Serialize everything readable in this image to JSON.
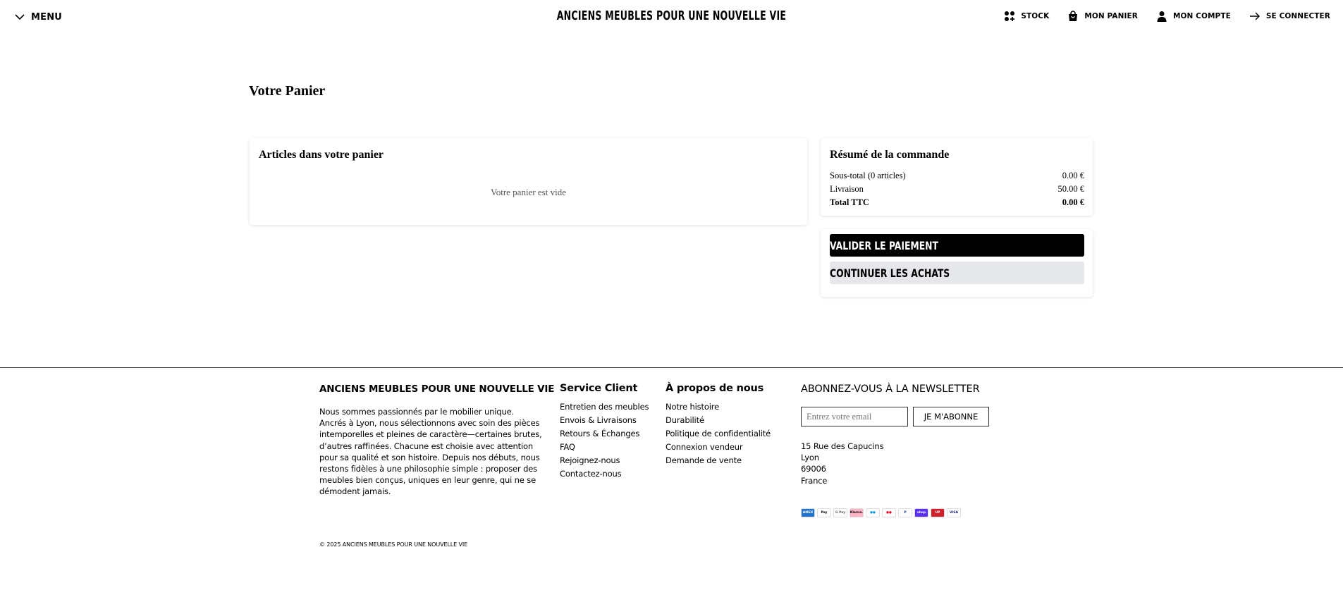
{
  "header": {
    "menu_label": "MENU",
    "logo": "ANCIENS MEUBLES POUR UNE NOUVELLE VIE",
    "nav": [
      {
        "label": "STOCK",
        "icon": "grid-plus-icon"
      },
      {
        "label": "MON PANIER",
        "icon": "shopping-bag-icon"
      },
      {
        "label": "MON COMPTE",
        "icon": "user-icon"
      },
      {
        "label": "SE CONNECTER",
        "icon": "arrow-right-icon"
      }
    ]
  },
  "main": {
    "page_title": "Votre Panier",
    "cart": {
      "title": "Articles dans votre panier",
      "empty_message": "Votre panier est vide"
    },
    "summary": {
      "title": "Résumé de la commande",
      "rows": [
        {
          "label": "Sous-total (0 articles)",
          "value": "0.00 €"
        },
        {
          "label": "Livraison",
          "value": "50.00 €"
        },
        {
          "label": "Total TTC",
          "value": "0.00 €"
        }
      ]
    },
    "actions": {
      "pay_label": "VALIDER LE PAIEMENT",
      "continue_label": "CONTINUER LES ACHATS"
    }
  },
  "footer": {
    "brand": "ANCIENS MEUBLES POUR UNE NOUVELLE VIE",
    "description": "Nous sommes passionnés par le mobilier unique. Ancrés à Lyon, nous sélectionnons avec soin des pièces intemporelles et pleines de caractère—certaines brutes, d’autres raffinées. Chacune est choisie avec attention pour sa qualité et son histoire. Depuis nos débuts, nous restons fidèles à une philosophie simple : proposer des meubles bien conçus, uniques en leur genre, qui ne se démodent jamais.",
    "service": {
      "title": "Service Client",
      "links": [
        "Entretien des meubles",
        "Envois & Livraisons",
        "Retours & Échanges",
        "FAQ",
        "Rejoignez-nous",
        "Contactez-nous"
      ]
    },
    "about": {
      "title": "À propos de nous",
      "links": [
        "Notre histoire",
        "Durabilité",
        "Politique de confidentialité",
        "Connexion vendeur",
        "Demande de vente"
      ]
    },
    "newsletter": {
      "title": "ABONNEZ-VOUS À LA NEWSLETTER",
      "placeholder": "Entrez votre email",
      "button": "JE M'ABONNE"
    },
    "address": [
      "15 Rue des Capucins",
      "Lyon",
      "69006",
      "France"
    ],
    "payments": [
      {
        "name": "AMEX",
        "bg": "#1f72cd",
        "fg": "#ffffff"
      },
      {
        "name": "Pay",
        "bg": "#ffffff",
        "fg": "#000000"
      },
      {
        "name": "G Pay",
        "bg": "#ffffff",
        "fg": "#5f6368"
      },
      {
        "name": "Klarna.",
        "bg": "#ffb3c7",
        "fg": "#000000"
      },
      {
        "name": "●●",
        "bg": "#ffffff",
        "fg": "#0099df"
      },
      {
        "name": "●●",
        "bg": "#ffffff",
        "fg": "#eb001b"
      },
      {
        "name": "P",
        "bg": "#ffffff",
        "fg": "#003087"
      },
      {
        "name": "shop",
        "bg": "#5a31f4",
        "fg": "#ffffff"
      },
      {
        "name": "UP",
        "bg": "#d21f2c",
        "fg": "#ffffff"
      },
      {
        "name": "VISA",
        "bg": "#ffffff",
        "fg": "#1a1f71"
      }
    ],
    "copyright": "© 2025 ANCIENS MEUBLES POUR UNE NOUVELLE VIE"
  }
}
